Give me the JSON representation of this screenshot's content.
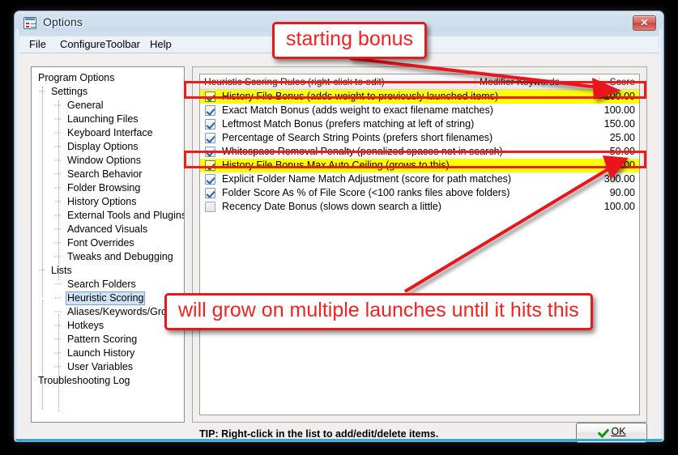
{
  "window": {
    "title": "Options",
    "icon": "options-list-icon",
    "close_label": "✕",
    "frame_accent": "#36a8da"
  },
  "menubar": {
    "items": [
      {
        "label": "File"
      },
      {
        "label": "ConfigureToolbar"
      },
      {
        "label": "Help"
      }
    ]
  },
  "tree": {
    "nodes": [
      {
        "label": "Program Options",
        "depth": 0,
        "selected": false
      },
      {
        "label": "Settings",
        "depth": 1,
        "selected": false
      },
      {
        "label": "General",
        "depth": 2,
        "selected": false
      },
      {
        "label": "Launching Files",
        "depth": 2,
        "selected": false
      },
      {
        "label": "Keyboard Interface",
        "depth": 2,
        "selected": false
      },
      {
        "label": "Display Options",
        "depth": 2,
        "selected": false
      },
      {
        "label": "Window Options",
        "depth": 2,
        "selected": false
      },
      {
        "label": "Search Behavior",
        "depth": 2,
        "selected": false
      },
      {
        "label": "Folder Browsing",
        "depth": 2,
        "selected": false
      },
      {
        "label": "History Options",
        "depth": 2,
        "selected": false
      },
      {
        "label": "External Tools and Plugins",
        "depth": 2,
        "selected": false
      },
      {
        "label": "Advanced Visuals",
        "depth": 2,
        "selected": false
      },
      {
        "label": "Font Overrides",
        "depth": 2,
        "selected": false
      },
      {
        "label": "Tweaks and Debugging",
        "depth": 2,
        "selected": false
      },
      {
        "label": "Lists",
        "depth": 1,
        "selected": false
      },
      {
        "label": "Search Folders",
        "depth": 2,
        "selected": false
      },
      {
        "label": "Heuristic Scoring",
        "depth": 2,
        "selected": true
      },
      {
        "label": "Aliases/Keywords/Groups",
        "depth": 2,
        "selected": false
      },
      {
        "label": "Hotkeys",
        "depth": 2,
        "selected": false
      },
      {
        "label": "Pattern Scoring",
        "depth": 2,
        "selected": false
      },
      {
        "label": "Launch History",
        "depth": 2,
        "selected": false
      },
      {
        "label": "User Variables",
        "depth": 2,
        "selected": false
      },
      {
        "label": "Troubleshooting Log",
        "depth": 0,
        "selected": false
      }
    ]
  },
  "list": {
    "columns": [
      {
        "label": "Heuristic Scoring Rules (right-click to edit)"
      },
      {
        "label": "Modifier Keywords"
      },
      {
        "label": "Score"
      }
    ],
    "rows": [
      {
        "checked": true,
        "label": "History File Bonus (adds weight to previously launched items)",
        "modifiers": "",
        "score": "100.00",
        "highlighted": true
      },
      {
        "checked": true,
        "label": "Exact Match Bonus (adds weight to exact filename matches)",
        "modifiers": "",
        "score": "100.00",
        "highlighted": false
      },
      {
        "checked": true,
        "label": "Leftmost Match Bonus (prefers matching at left of string)",
        "modifiers": "",
        "score": "150.00",
        "highlighted": false
      },
      {
        "checked": true,
        "label": "Percentage of Search String Points (prefers short filenames)",
        "modifiers": "",
        "score": "25.00",
        "highlighted": false
      },
      {
        "checked": true,
        "label": "Whitespace Removal Penalty (penalized spaces not in search)",
        "modifiers": "",
        "score": "-50.00",
        "highlighted": false
      },
      {
        "checked": true,
        "label": "History File Bonus Max Auto Ceiling (grows to this)",
        "modifiers": "",
        "score": "110.00",
        "highlighted": true
      },
      {
        "checked": true,
        "label": "Explicit Folder Name Match Adjustment (score for path matches)",
        "modifiers": "",
        "score": "300.00",
        "highlighted": false
      },
      {
        "checked": true,
        "label": "Folder Score As % of File Score (<100 ranks files above folders)",
        "modifiers": "",
        "score": "90.00",
        "highlighted": false
      },
      {
        "checked": false,
        "label": "Recency Date Bonus (slows down search a little)",
        "modifiers": "",
        "score": "100.00",
        "highlighted": false
      }
    ]
  },
  "footer": {
    "tip": "TIP: Right-click in the list to add/edit/delete items.",
    "ok_label": "OK",
    "ok_accesskey": "O"
  },
  "annotations": {
    "color": "#ee2323",
    "callouts": [
      {
        "id": "starting-bonus",
        "text": "starting bonus"
      },
      {
        "id": "will-grow",
        "text": "will grow on multiple launches until it hits this"
      }
    ]
  }
}
